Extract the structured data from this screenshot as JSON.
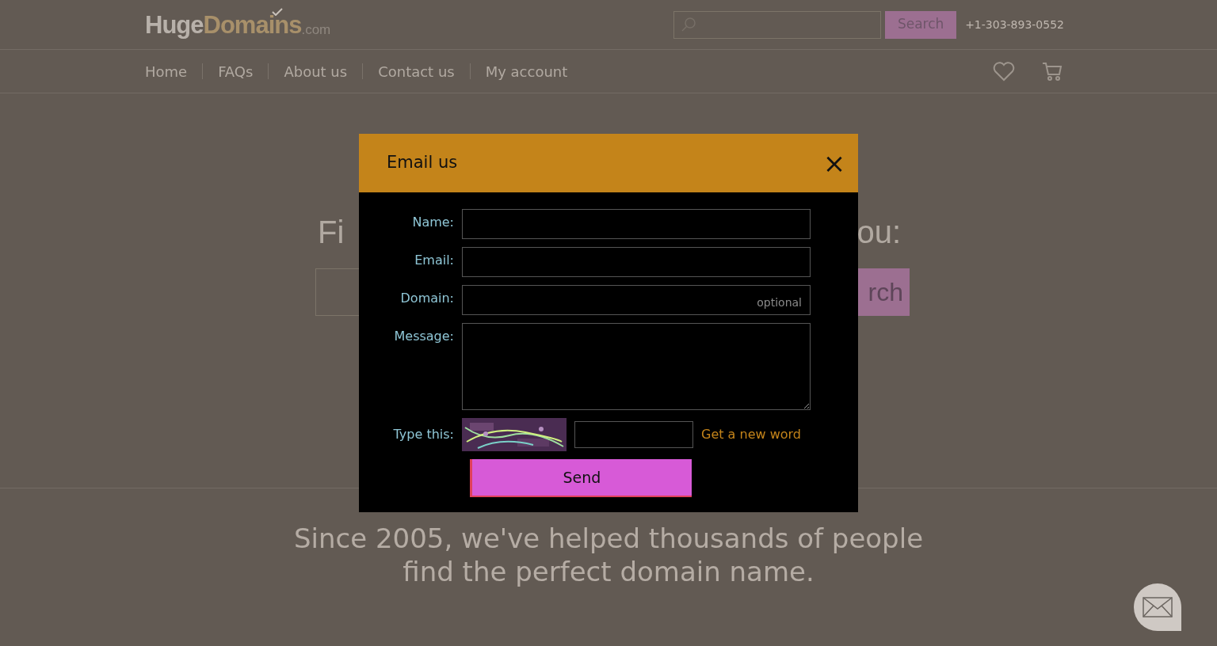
{
  "header": {
    "logo": {
      "part_1": "Huge",
      "part_2": "Domains",
      "part_3": ".com"
    },
    "search": {
      "button": "Search"
    },
    "phone": "+1-303-893-0552"
  },
  "nav": {
    "items": [
      {
        "label": "Home"
      },
      {
        "label": "FAQs"
      },
      {
        "label": "About us"
      },
      {
        "label": "Contact us"
      },
      {
        "label": "My account"
      }
    ]
  },
  "hero": {
    "heading_left": "Fi",
    "heading_right": "ou:",
    "search_button": "rch"
  },
  "tagline": [
    "Since 2005, we've helped thousands of people",
    "find the perfect domain name."
  ],
  "dialog": {
    "title": "Email us",
    "close": "×",
    "fields": [
      {
        "label": "Name:",
        "kind": "input"
      },
      {
        "label": "Email:",
        "kind": "input"
      },
      {
        "label": "Domain:",
        "kind": "input",
        "placeholder": "optional"
      },
      {
        "label": "Message:",
        "kind": "textarea"
      }
    ],
    "captcha": {
      "label": "Type this:",
      "link": "Get a new word"
    },
    "send": "Send"
  }
}
